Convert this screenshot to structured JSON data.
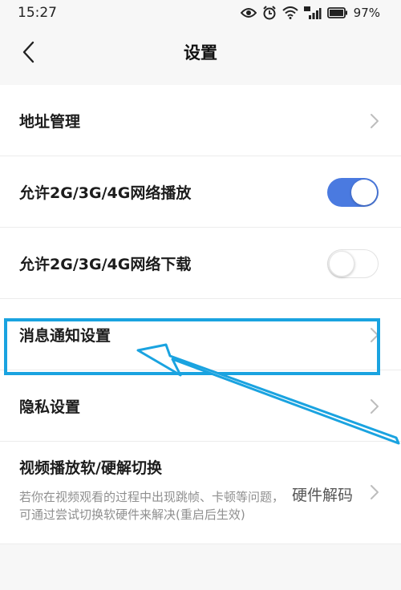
{
  "status_bar": {
    "time": "15:27",
    "battery": "97%"
  },
  "nav": {
    "title": "设置"
  },
  "settings": {
    "address": {
      "label": "地址管理"
    },
    "network_play": {
      "label": "允许2G/3G/4G网络播放",
      "enabled": true
    },
    "network_download": {
      "label": "允许2G/3G/4G网络下载",
      "enabled": false
    },
    "notification": {
      "label": "消息通知设置"
    },
    "privacy": {
      "label": "隐私设置"
    },
    "decode": {
      "label": "视频播放软/硬解切换",
      "description": "若你在视频观看的过程中出现跳帧、卡顿等问题，可通过尝试切换软硬件来解决(重启后生效)",
      "value": "硬件解码"
    }
  },
  "colors": {
    "toggle_on": "#4a7ae0",
    "highlight": "#1aa3e0"
  }
}
